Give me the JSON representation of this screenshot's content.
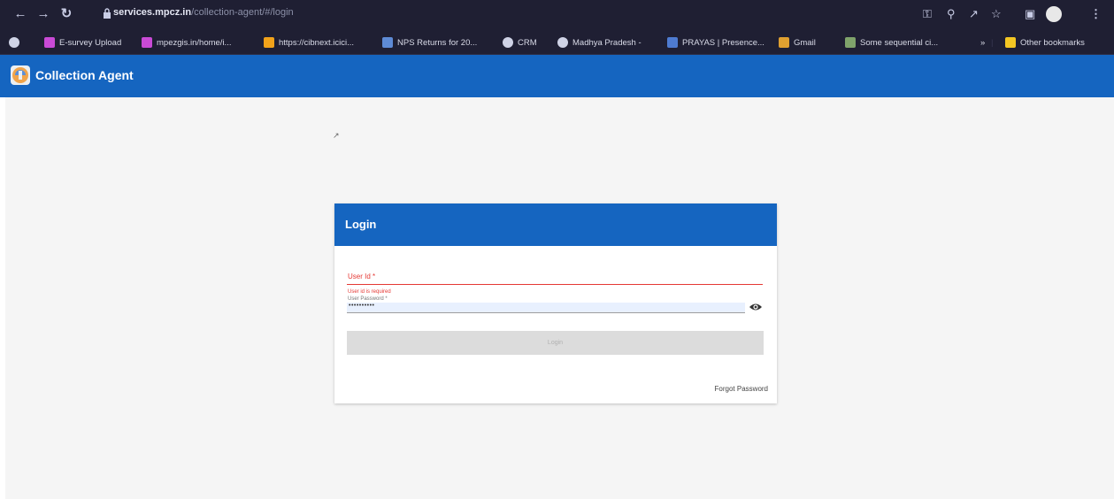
{
  "browser": {
    "url_host": "services.mpcz.in",
    "url_path": "/collection-agent/#/login",
    "bookmarks": [
      {
        "label": "E-survey Upload",
        "color": "#c94ad6"
      },
      {
        "label": "mpezgis.in/home/i...",
        "color": "#c94ad6"
      },
      {
        "label": "https://cibnext.icici...",
        "color": "#f1a21a"
      },
      {
        "label": "NPS Returns for 20...",
        "color": "#5e8bd6"
      },
      {
        "label": "CRM",
        "color": "#cfd3e6"
      },
      {
        "label": "Madhya Pradesh -",
        "color": "#cfd3e6"
      },
      {
        "label": "PRAYAS | Presence...",
        "color": "#4e7bd1"
      },
      {
        "label": "Gmail",
        "color": "#e0a030"
      },
      {
        "label": "Some sequential ci...",
        "color": "#7fa36b"
      }
    ],
    "more_bookmarks": "»",
    "other_bookmarks": "Other bookmarks"
  },
  "app": {
    "title": "Collection Agent",
    "brand_color": "#1565c0"
  },
  "login": {
    "heading": "Login",
    "user_id_label": "User Id *",
    "user_id_error": "User id is required",
    "password_label": "User Password *",
    "password_value": "••••••••••",
    "login_button": "Login",
    "forgot_password": "Forgot Password",
    "error_color": "#e53935"
  }
}
